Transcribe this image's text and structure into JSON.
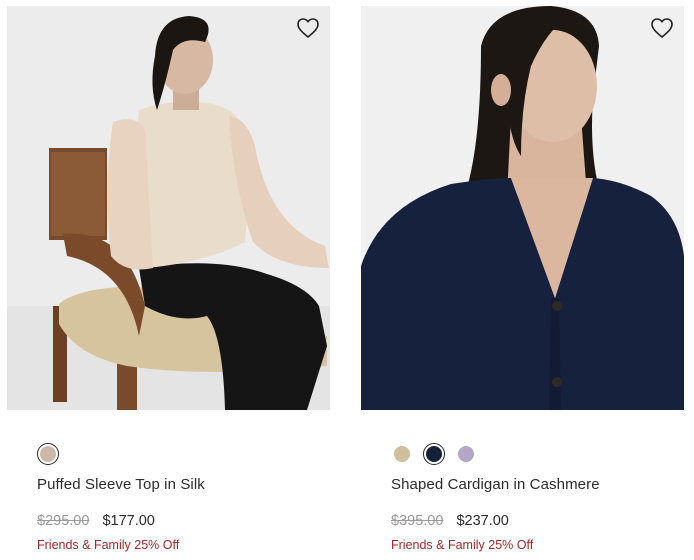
{
  "products": [
    {
      "name": "Puffed Sleeve Top in Silk",
      "original_price": "$295.00",
      "sale_price": "$177.00",
      "promo": "Friends & Family 25% Off",
      "image": "woman-seated-in-cream-silk-top-on-wooden-chair",
      "wishlist_icon": "heart-outline-icon",
      "swatches": [
        {
          "color": "#cdb8aa",
          "selected": true
        }
      ]
    },
    {
      "name": "Shaped Cardigan in Cashmere",
      "original_price": "$395.00",
      "sale_price": "$237.00",
      "promo": "Friends & Family 25% Off",
      "image": "woman-in-navy-cashmere-cardigan",
      "wishlist_icon": "heart-outline-icon",
      "swatches": [
        {
          "color": "#cfbf9f",
          "selected": false
        },
        {
          "color": "#15203a",
          "selected": true
        },
        {
          "color": "#b3a6c9",
          "selected": false
        }
      ]
    }
  ],
  "colors": {
    "promo": "#9b2a2a",
    "strikethrough_price": "#9a9a9a",
    "text": "#2b2b2b"
  }
}
